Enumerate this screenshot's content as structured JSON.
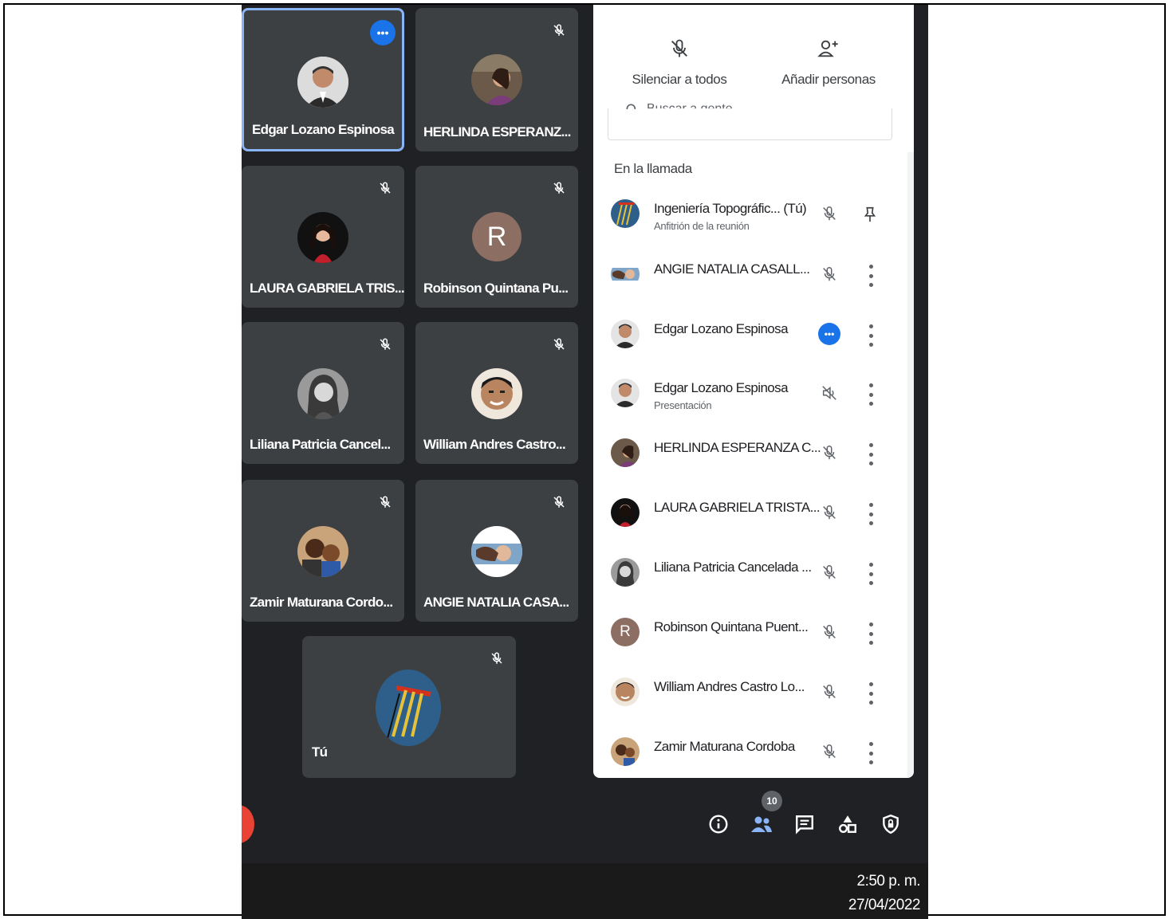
{
  "tiles": [
    {
      "name": "Edgar Lozano Espinosa",
      "status": "more-options"
    },
    {
      "name": "HERLINDA ESPERANZ...",
      "status": "muted"
    },
    {
      "name": "LAURA GABRIELA TRIS...",
      "status": "muted"
    },
    {
      "name": "Robinson Quintana Pu...",
      "status": "muted",
      "initial": "R"
    },
    {
      "name": "Liliana Patricia Cancel...",
      "status": "muted"
    },
    {
      "name": "William Andres Castro...",
      "status": "muted"
    },
    {
      "name": "Zamir Maturana Cordo...",
      "status": "muted"
    },
    {
      "name": "ANGIE NATALIA CASA...",
      "status": "muted"
    },
    {
      "name": "Tú",
      "status": "muted"
    }
  ],
  "panel": {
    "mute_all_label": "Silenciar a todos",
    "add_people_label": "Añadir personas",
    "search_placeholder": "Buscar a gente",
    "section_title": "En la llamada",
    "participants": [
      {
        "name": "Ingeniería Topográfic... (Tú)",
        "subtitle": "Anfitrión de la reunión",
        "state": "muted",
        "action": "pin"
      },
      {
        "name": "ANGIE NATALIA CASALL...",
        "subtitle": "",
        "state": "muted",
        "action": "more"
      },
      {
        "name": "Edgar Lozano Espinosa",
        "subtitle": "",
        "state": "more-options",
        "action": "more"
      },
      {
        "name": "Edgar Lozano Espinosa",
        "subtitle": "Presentación",
        "state": "audio-off",
        "action": "more"
      },
      {
        "name": "HERLINDA ESPERANZA C...",
        "subtitle": "",
        "state": "muted",
        "action": "more"
      },
      {
        "name": "LAURA GABRIELA TRISTA...",
        "subtitle": "",
        "state": "muted",
        "action": "more"
      },
      {
        "name": "Liliana Patricia Cancelada ...",
        "subtitle": "",
        "state": "muted",
        "action": "more"
      },
      {
        "name": "Robinson Quintana Puent...",
        "subtitle": "",
        "state": "muted",
        "action": "more",
        "initial": "R"
      },
      {
        "name": "William Andres Castro Lo...",
        "subtitle": "",
        "state": "muted",
        "action": "more"
      },
      {
        "name": "Zamir Maturana Cordoba",
        "subtitle": "",
        "state": "muted",
        "action": "more"
      }
    ]
  },
  "bottom_bar": {
    "participants_count": "10",
    "icons": [
      "info-icon",
      "people-icon",
      "chat-icon",
      "activities-icon",
      "safety-icon"
    ]
  },
  "taskbar": {
    "time": "2:50 p. m.",
    "date": "27/04/2022"
  },
  "colors": {
    "background": "#202124",
    "tile": "#3c4043",
    "accent": "#1a73e8",
    "end_call": "#ea4335"
  }
}
